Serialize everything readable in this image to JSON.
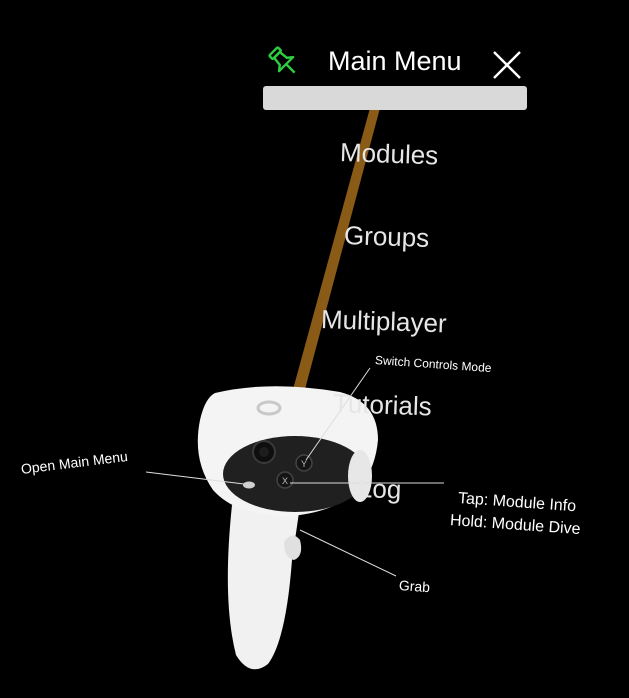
{
  "menu": {
    "title": "Main Menu",
    "items": [
      {
        "label": "Modules"
      },
      {
        "label": "Groups"
      },
      {
        "label": "Multiplayer"
      },
      {
        "label": "Tutorials"
      },
      {
        "label": "Log"
      }
    ]
  },
  "callouts": {
    "switch_controls": "Switch Controls Mode",
    "open_main_menu": "Open Main Menu",
    "tap": "Tap: Module Info",
    "hold": "Hold: Module Dive",
    "grab": "Grab"
  },
  "controller": {
    "buttons": {
      "y": "Y",
      "x": "X",
      "menu": "≡"
    }
  },
  "icons": {
    "pin": "pin-icon",
    "close": "close-icon"
  },
  "colors": {
    "pin": "#2ecc40",
    "ray": "#8a5a17",
    "controller": "#f2f2f2",
    "background": "#000000"
  }
}
